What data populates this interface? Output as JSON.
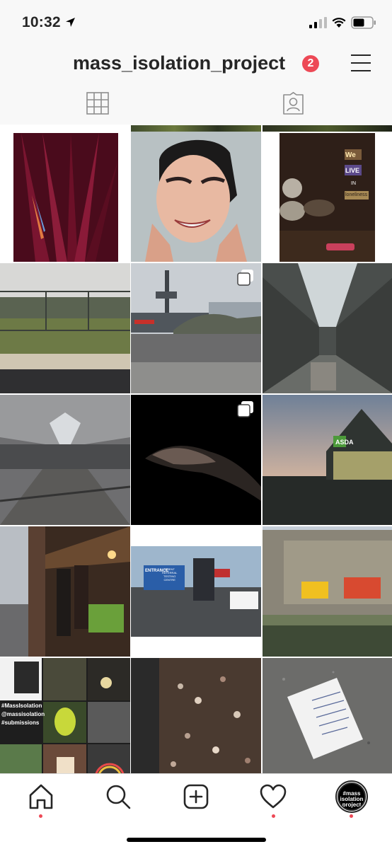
{
  "status_bar": {
    "time": "10:32"
  },
  "header": {
    "profile_name": "mass_isolation_project",
    "notification_count": "2"
  },
  "tabs": [
    "grid-icon",
    "tagged-icon"
  ],
  "posts": [
    {
      "subject": "red leaves close-up"
    },
    {
      "subject": "smiling woman portrait"
    },
    {
      "subject": "We LIVE IN loneliness sign",
      "text": [
        "We",
        "LIVE",
        "IN",
        "loneliness"
      ]
    },
    {
      "subject": "fence and field"
    },
    {
      "subject": "warship at dock",
      "multiple": true
    },
    {
      "subject": "empty shopping mall"
    },
    {
      "subject": "empty mall concourse"
    },
    {
      "subject": "hand in darkness",
      "multiple": true
    },
    {
      "subject": "supermarket at dusk",
      "text": [
        "ASDA"
      ]
    },
    {
      "subject": "shoppers with trolleys"
    },
    {
      "subject": "testing centre sign",
      "text": [
        "ENTRANCE",
        "CLIENT",
        "REFERRAL",
        "TESTING",
        "CENTRE"
      ]
    },
    {
      "subject": "hotel building with billboards"
    },
    {
      "subject": "collage submissions",
      "text": [
        "#MassIsolation",
        "@massisolation",
        "#submissions"
      ]
    },
    {
      "subject": "hedge close-up"
    },
    {
      "subject": "note on ground"
    }
  ],
  "bottom_nav": {
    "items": [
      "home-icon",
      "search-icon",
      "new-post-icon",
      "activity-icon",
      "profile-avatar"
    ],
    "avatar_text": [
      "#mass",
      "isolation",
      "project"
    ]
  },
  "colors": {
    "accent": "#ed4956",
    "background": "#f8f8f8",
    "text": "#262626"
  }
}
